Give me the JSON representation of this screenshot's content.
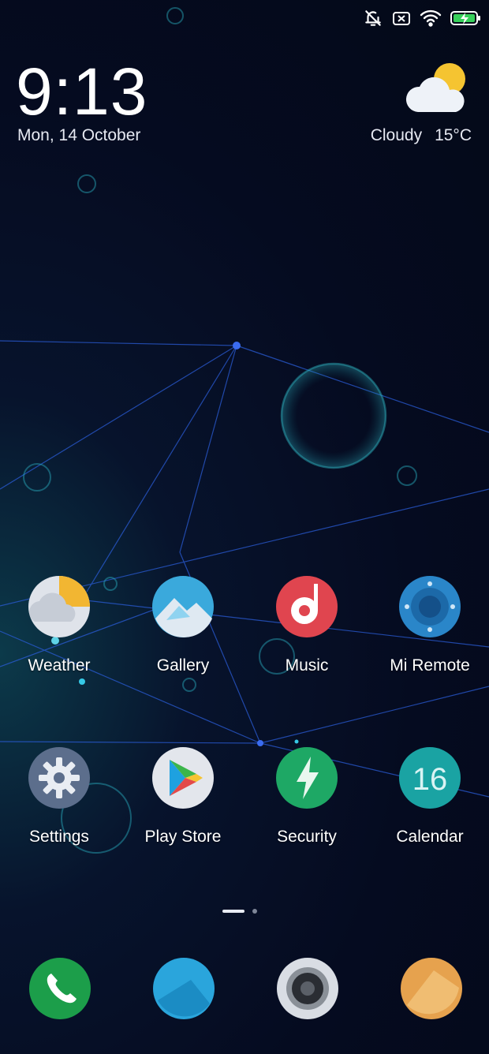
{
  "status_bar": {
    "icons": [
      "muted-bell-icon",
      "no-sim-icon",
      "wifi-icon",
      "battery-charging-icon"
    ]
  },
  "lockscreen_widget": {
    "time": "9:13",
    "date": "Mon, 14 October",
    "weather": {
      "condition": "Cloudy",
      "temperature": "15°C",
      "icon": "partly-cloudy-icon"
    }
  },
  "home": {
    "apps_row1": [
      {
        "label": "Weather",
        "icon": "weather-app-icon"
      },
      {
        "label": "Gallery",
        "icon": "gallery-app-icon"
      },
      {
        "label": "Music",
        "icon": "music-app-icon"
      },
      {
        "label": "Mi Remote",
        "icon": "mi-remote-app-icon"
      }
    ],
    "apps_row2": [
      {
        "label": "Settings",
        "icon": "settings-app-icon"
      },
      {
        "label": "Play Store",
        "icon": "play-store-app-icon"
      },
      {
        "label": "Security",
        "icon": "security-app-icon"
      },
      {
        "label": "Calendar",
        "icon": "calendar-app-icon",
        "day": "16"
      }
    ],
    "page_indicator": {
      "pages": 2,
      "current": 1
    },
    "dock": [
      {
        "icon": "phone-app-icon"
      },
      {
        "icon": "messaging-app-icon"
      },
      {
        "icon": "camera-app-icon"
      },
      {
        "icon": "notes-app-icon"
      }
    ]
  },
  "colors": {
    "background": "#050b20",
    "network_lines": "#2a5cd6",
    "weather_gold": "#f2b632",
    "gallery_blue": "#3aa9dc",
    "music_red": "#e0454f",
    "remote_blue": "#2a86c9",
    "settings_slate": "#5c6e8c",
    "security_green": "#1ea865",
    "calendar_teal": "#1aa3a3",
    "phone_green": "#1c9e4a",
    "notes_orange": "#e6a24e"
  }
}
